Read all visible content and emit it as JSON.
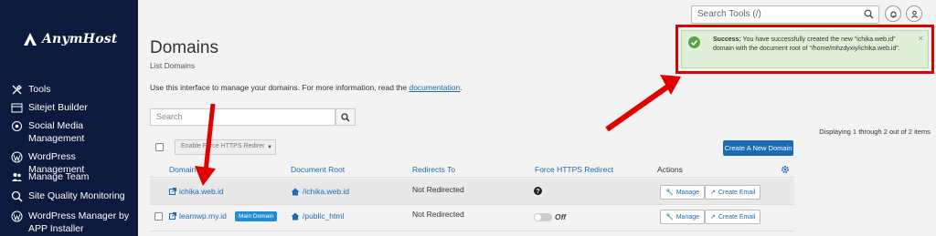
{
  "sidebar": {
    "logo_text": "AnymHost",
    "items": [
      {
        "label": "Tools",
        "icon": "tools-icon"
      },
      {
        "label": "Sitejet Builder",
        "icon": "sitejet-icon"
      },
      {
        "label": "Social Media Management",
        "icon": "social-icon"
      },
      {
        "label": "WordPress Management",
        "icon": "wordpress-icon"
      },
      {
        "label": "Manage Team",
        "icon": "team-icon"
      },
      {
        "label": "Site Quality Monitoring",
        "icon": "monitor-icon"
      },
      {
        "label": "WordPress Manager by APP Installer",
        "icon": "wordpress-icon"
      }
    ]
  },
  "header": {
    "search_placeholder": "Search Tools (/)"
  },
  "page": {
    "title": "Domains",
    "breadcrumb": "List Domains",
    "intro_text": "Use this interface to manage your domains. For more information, read the ",
    "intro_link": "documentation",
    "intro_end": "."
  },
  "toolbar": {
    "search_placeholder": "Search",
    "displaying": "Displaying 1 through 2 out of 2 items",
    "bulk_label": "Enable Force HTTPS Redirect",
    "create_label": "Create A New Domain"
  },
  "table": {
    "headers": {
      "domain": "Domain",
      "docroot": "Document Root",
      "redirects": "Redirects To",
      "force_https": "Force HTTPS Redirect",
      "actions": "Actions"
    },
    "rows": [
      {
        "domain": "ichika.web.id",
        "docroot": "/ichika.web.id",
        "redirects": "Not Redirected",
        "badge": "",
        "force_https": "unknown"
      },
      {
        "domain": "learnwp.my.id",
        "docroot": "/public_html",
        "redirects": "Not Redirected",
        "badge": "Main Domain",
        "force_https": "Off"
      }
    ],
    "manage_label": "Manage",
    "email_label": "Create Email"
  },
  "alert": {
    "strong": "Success:",
    "message": " You have successfully created the new “ichika.web.id” domain with the document root of “/home/mhzdyxiy/ichika.web.id”.",
    "close": "×"
  },
  "colors": {
    "sidebar": "#0c1a3e",
    "link": "#1b6bb5",
    "alert_bg": "#dff0d8",
    "annotation": "#e00000"
  }
}
